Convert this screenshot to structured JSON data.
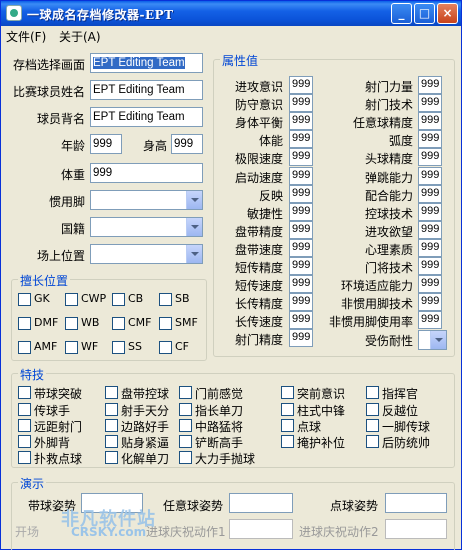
{
  "window": {
    "title": "一球成名存档修改器-EPT",
    "min": "_",
    "max": "□",
    "close": "×"
  },
  "menu": [
    "文件(F)",
    "关于(A)"
  ],
  "basic": {
    "save_slot_label": "存档选择画面",
    "save_slot_value": "EPT Editing Team",
    "match_name_label": "比赛球员姓名",
    "match_name_value": "EPT Editing Team",
    "back_name_label": "球员背名",
    "back_name_value": "EPT Editing Team",
    "age_label": "年龄",
    "age_value": "999",
    "height_label": "身高",
    "height_value": "999",
    "weight_label": "体重",
    "weight_value": "999",
    "foot_label": "惯用脚",
    "nation_label": "国籍",
    "position_label": "场上位置"
  },
  "positions": {
    "title": "擅长位置",
    "items": [
      "GK",
      "CWP",
      "CB",
      "SB",
      "DMF",
      "WB",
      "CMF",
      "SMF",
      "AMF",
      "WF",
      "SS",
      "CF"
    ]
  },
  "attrs": {
    "title": "属性值",
    "left": [
      {
        "label": "进攻意识",
        "value": "999"
      },
      {
        "label": "防守意识",
        "value": "999"
      },
      {
        "label": "身体平衡",
        "value": "999"
      },
      {
        "label": "体能",
        "value": "999"
      },
      {
        "label": "极限速度",
        "value": "999"
      },
      {
        "label": "启动速度",
        "value": "999"
      },
      {
        "label": "反映",
        "value": "999"
      },
      {
        "label": "敏捷性",
        "value": "999"
      },
      {
        "label": "盘带精度",
        "value": "999"
      },
      {
        "label": "盘带速度",
        "value": "999"
      },
      {
        "label": "短传精度",
        "value": "999"
      },
      {
        "label": "短传速度",
        "value": "999"
      },
      {
        "label": "长传精度",
        "value": "999"
      },
      {
        "label": "长传速度",
        "value": "999"
      },
      {
        "label": "射门精度",
        "value": "999"
      }
    ],
    "right": [
      {
        "label": "射门力量",
        "value": "999"
      },
      {
        "label": "射门技术",
        "value": "999"
      },
      {
        "label": "任意球精度",
        "value": "999"
      },
      {
        "label": "弧度",
        "value": "999"
      },
      {
        "label": "头球精度",
        "value": "999"
      },
      {
        "label": "弹跳能力",
        "value": "999"
      },
      {
        "label": "配合能力",
        "value": "999"
      },
      {
        "label": "控球技术",
        "value": "999"
      },
      {
        "label": "进攻欲望",
        "value": "999"
      },
      {
        "label": "心理素质",
        "value": "999"
      },
      {
        "label": "门将技术",
        "value": "999"
      },
      {
        "label": "环境适应能力",
        "value": "999"
      },
      {
        "label": "非惯用脚技术",
        "value": "999"
      },
      {
        "label": "非惯用脚使用率",
        "value": "999"
      }
    ],
    "injury_label": "受伤耐性"
  },
  "skills": {
    "title": "特技",
    "items": [
      "带球突破",
      "盘带控球",
      "门前感觉",
      "突前意识",
      "指挥官",
      "传球手",
      "射手天分",
      "指长单刀",
      "柱式中锋",
      "反越位",
      "远距射门",
      "边路好手",
      "中路猛将",
      "点球",
      "一脚传球",
      "外脚背",
      "贴身紧逼",
      "铲断高手",
      "掩护补位",
      "后防统帅",
      "扑救点球",
      "化解单刀",
      "大力手抛球"
    ]
  },
  "demo": {
    "title": "演示",
    "dribble_label": "带球姿势",
    "freekick_label": "任意球姿势",
    "penalty_label": "点球姿势",
    "celebrate1_label": "进球庆祝动作1",
    "celebrate2_label": "进球庆祝动作2",
    "open_label": "开场"
  },
  "watermark": {
    "line1": "非凡软件站",
    "line2": "CRSKY.com"
  }
}
